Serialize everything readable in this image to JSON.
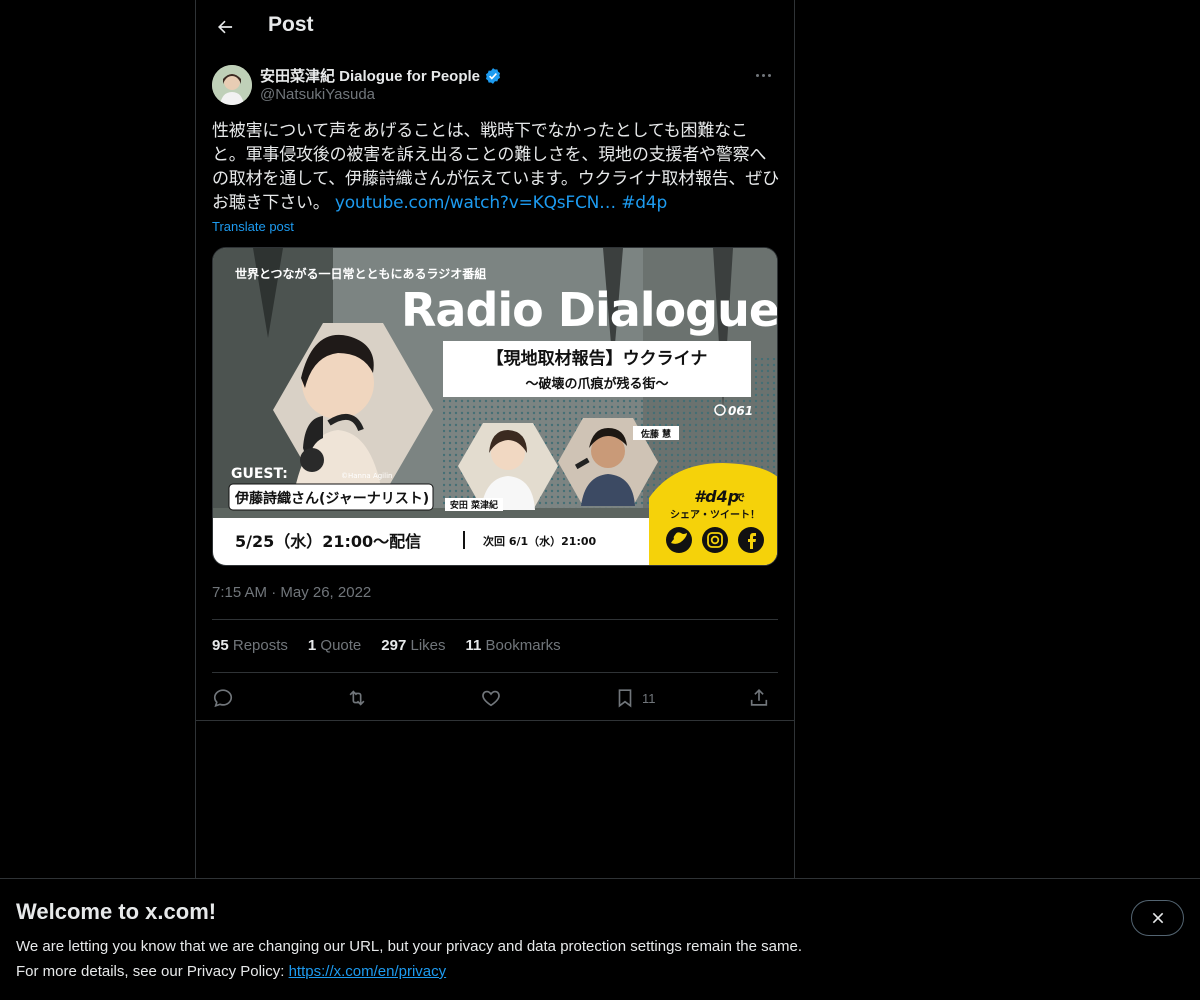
{
  "header": {
    "title": "Post"
  },
  "author": {
    "name": "安田菜津紀 Dialogue for People",
    "handle": "@NatsukiYasuda"
  },
  "post": {
    "text": "性被害について声をあげることは、戦時下でなかったとしても困難なこと。軍事侵攻後の被害を訴え出ることの難しさを、現地の支援者や警察への取材を通して、伊藤詩織さんが伝えています。ウクライナ取材報告、ぜひお聴き下さい。",
    "link": "youtube.com/watch?v=KQsFCN…",
    "hashtag": "#d4p",
    "translate": "Translate post",
    "timestamp": "7:15 AM · May 26, 2022"
  },
  "media": {
    "top_caption": "世界とつながる一日常とともにあるラジオ番組",
    "title": "Radio Dialogue",
    "headline": "【現地取材報告】ウクライナ",
    "subheadline": "〜破壊の爪痕が残る街〜",
    "episode": "061",
    "guest_label": "GUEST:",
    "guest_name": "伊藤詩織さん(ジャーナリスト)",
    "photo_credit": "©Hanna Agilin",
    "host1": "安田 菜津紀",
    "host2": "佐藤 慧",
    "date_line": "5/25（水）21:00〜配信",
    "next_line": "次回 6/1（水）21:00",
    "share_tag": "#d4p",
    "share_de": "で",
    "share_text": "シェア・ツイート！"
  },
  "stats": {
    "reposts_count": "95",
    "reposts_label": "Reposts",
    "quotes_count": "1",
    "quotes_label": "Quote",
    "likes_count": "297",
    "likes_label": "Likes",
    "bookmarks_count": "11",
    "bookmarks_label": "Bookmarks"
  },
  "actions": {
    "bookmark_count": "11"
  },
  "banner": {
    "title": "Welcome to x.com!",
    "text1": "We are letting you know that we are changing our URL, but your privacy and data protection settings remain the same.",
    "text2_prefix": "For more details, see our Privacy Policy: ",
    "privacy_link": "https://x.com/en/privacy"
  },
  "colors": {
    "accent": "#1d9bf0",
    "background": "#000000",
    "muted": "#71767b",
    "border": "#2f3336",
    "media_yellow": "#f5d20a"
  },
  "icons": [
    "back-arrow-icon",
    "verified-badge-icon",
    "more-icon",
    "reply-icon",
    "repost-icon",
    "like-icon",
    "bookmark-icon",
    "share-icon",
    "close-icon"
  ]
}
